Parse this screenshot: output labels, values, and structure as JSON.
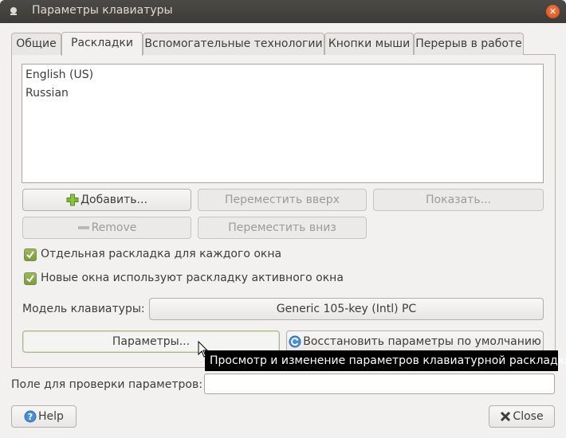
{
  "window": {
    "title": "Параметры клавиатуры"
  },
  "tabs": [
    {
      "label": "Общие"
    },
    {
      "label": "Раскладки"
    },
    {
      "label": "Вспомогательные технологии"
    },
    {
      "label": "Кнопки мыши"
    },
    {
      "label": "Перерыв в работе"
    }
  ],
  "layouts": {
    "items": [
      "English (US)",
      "Russian"
    ]
  },
  "buttons": {
    "add": "Добавить...",
    "move_up": "Переместить вверх",
    "show": "Показать...",
    "remove": "Remove",
    "move_down": "Переместить вниз",
    "options": "Параметры...",
    "reset": "Восстановить параметры по умолчанию",
    "help": "Help",
    "close": "Close"
  },
  "checkboxes": [
    {
      "label": "Отдельная раскладка для каждого окна",
      "checked": true
    },
    {
      "label": "Новые окна используют раскладку активного окна",
      "checked": true
    }
  ],
  "model": {
    "label": "Модель клавиатуры:",
    "value": "Generic 105-key (Intl) PC"
  },
  "tooltip": {
    "text": "Просмотр и изменение параметров клавиатурной раскладки"
  },
  "test_field": {
    "label": "Поле для проверки параметров:",
    "value": ""
  },
  "colors": {
    "accent_green": "#7a9c3a",
    "close_orange": "#e0562a",
    "titlebar": "#3c3b37"
  }
}
